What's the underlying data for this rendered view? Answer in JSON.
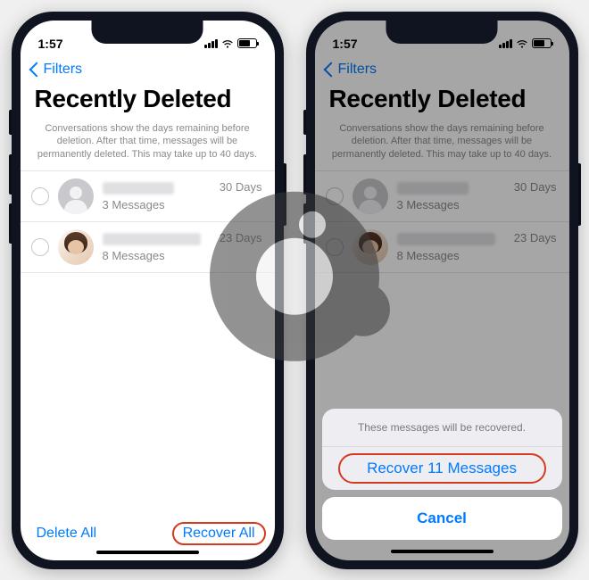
{
  "statusbar": {
    "time": "1:57"
  },
  "nav": {
    "back_label": "Filters"
  },
  "page": {
    "title": "Recently Deleted",
    "subtitle": "Conversations show the days remaining before deletion. After that time, messages will be permanently deleted. This may take up to 40 days."
  },
  "conversations": [
    {
      "message_count": "3 Messages",
      "days_remaining": "30 Days"
    },
    {
      "message_count": "8 Messages",
      "days_remaining": "23 Days"
    }
  ],
  "toolbar": {
    "delete_all_label": "Delete All",
    "recover_all_label": "Recover All"
  },
  "sheet": {
    "message": "These messages will be recovered.",
    "recover_label": "Recover 11 Messages",
    "cancel_label": "Cancel"
  }
}
